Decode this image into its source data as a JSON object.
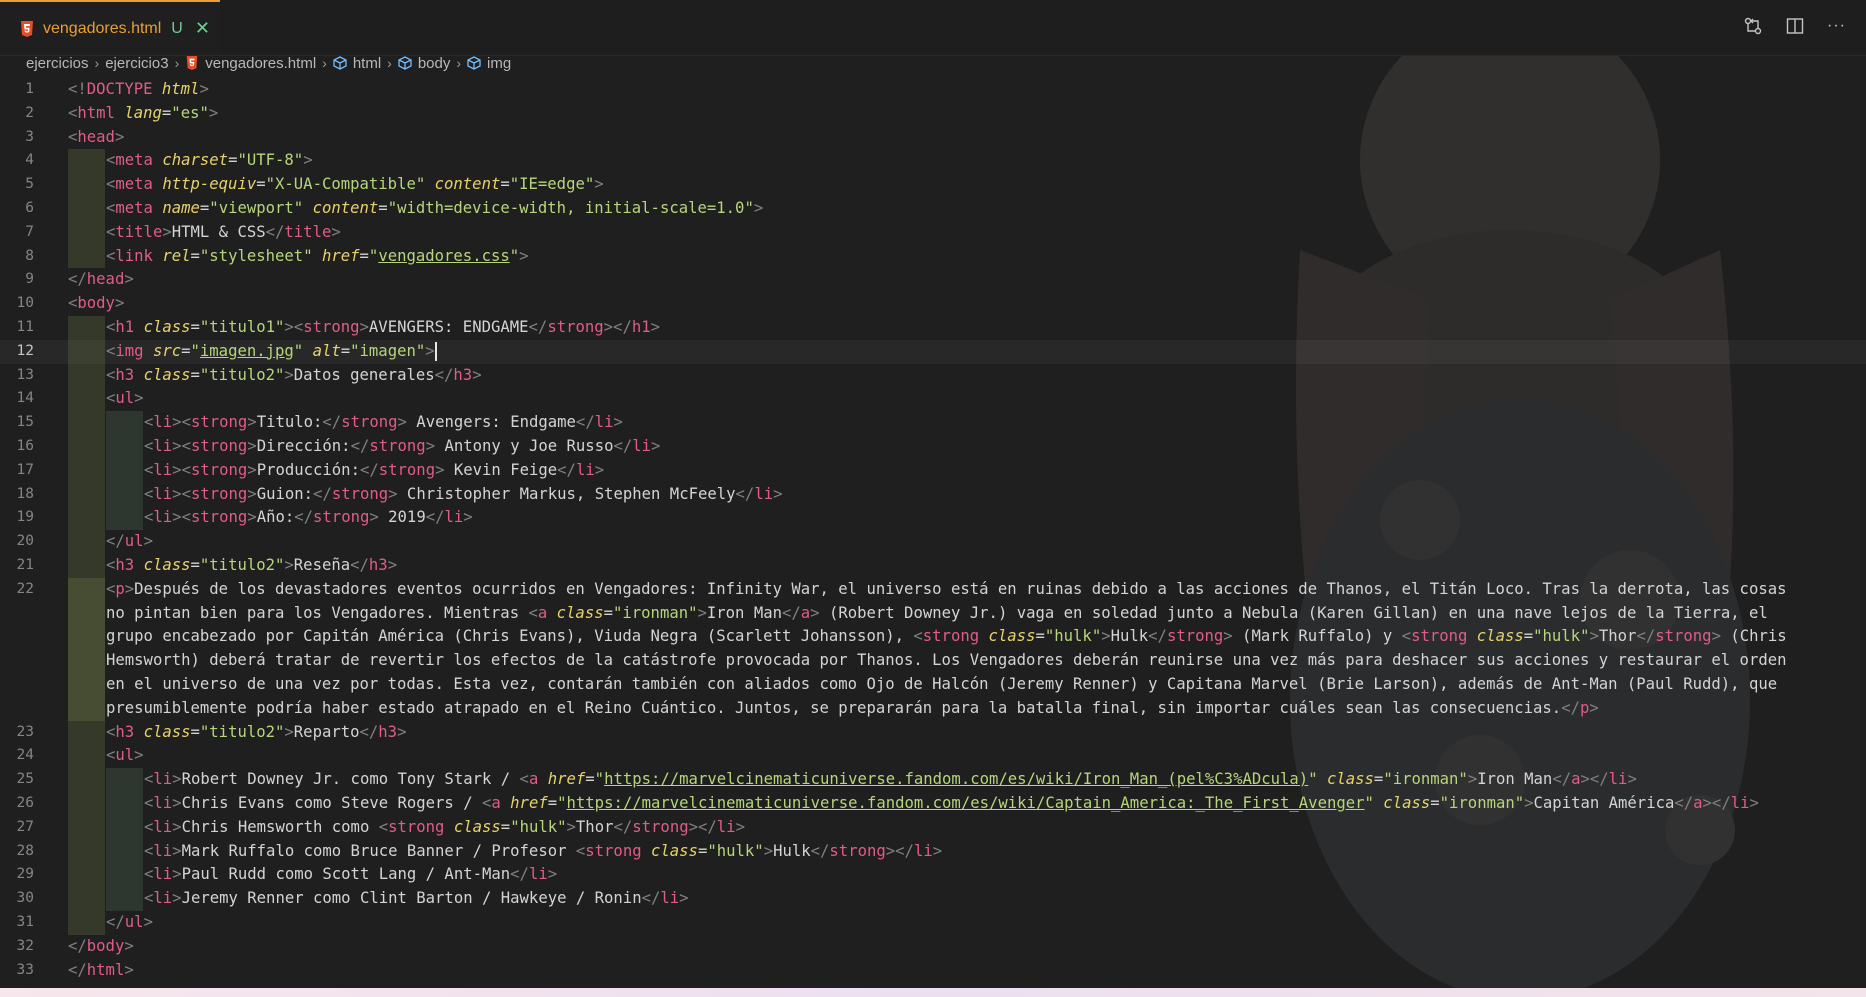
{
  "tab": {
    "filename": "vengadores.html",
    "status": "U",
    "close": "✕"
  },
  "toolbar": {
    "icons": [
      "source-control-compare-icon",
      "split-editor-icon",
      "more-actions-icon"
    ],
    "more_label": "···"
  },
  "breadcrumb": {
    "items": [
      "ejercicios",
      "ejercicio3",
      "vengadores.html",
      "html",
      "body",
      "img"
    ]
  },
  "editor": {
    "active_line": 12,
    "lines": [
      "<!DOCTYPE html>",
      "<html lang=\"es\">",
      "<head>",
      "<meta charset=\"UTF-8\">",
      "<meta http-equiv=\"X-UA-Compatible\" content=\"IE=edge\">",
      "<meta name=\"viewport\" content=\"width=device-width, initial-scale=1.0\">",
      "<title>HTML & CSS</title>",
      "<link rel=\"stylesheet\" href=\"vengadores.css\">",
      "</head>",
      "<body>",
      "<h1 class=\"titulo1\"><strong>AVENGERS: ENDGAME</strong></h1>",
      "<img src=\"imagen.jpg\" alt=\"imagen\">",
      "<h3 class=\"titulo2\">Datos generales</h3>",
      "<ul>",
      "<li><strong>Titulo:</strong> Avengers: Endgame</li>",
      "<li><strong>Dirección:</strong> Antony y Joe Russo</li>",
      "<li><strong>Producción:</strong> Kevin Feige</li>",
      "<li><strong>Guion:</strong> Christopher Markus, Stephen McFeely</li>",
      "<li><strong>Año:</strong> 2019</li>",
      "</ul>",
      "<h3 class=\"titulo2\">Reseña</h3>",
      "<p>Después de los devastadores eventos ocurridos en Vengadores: Infinity War, el universo está en ruinas debido a las acciones de Thanos, el Titán Loco. Tras la derrota, las cosas no pintan bien para los Vengadores. Mientras <a class=\"ironman\">Iron Man</a> (Robert Downey Jr.) vaga en soledad junto a Nebula (Karen Gillan) en una nave lejos de la Tierra, el grupo encabezado por Capitán América (Chris Evans), Viuda Negra (Scarlett Johansson), <strong class=\"hulk\">Hulk</strong> (Mark Ruffalo) y <strong class=\"hulk\">Thor</strong> (Chris Hemsworth) deberá tratar de revertir los efectos de la catástrofe provocada por Thanos. Los Vengadores deberán reunirse una vez más para deshacer sus acciones y restaurar el orden en el universo de una vez por todas. Esta vez, contarán también con aliados como Ojo de Halcón (Jeremy Renner) y Capitana Marvel (Brie Larson), además de Ant-Man (Paul Rudd), que presumiblemente podría haber estado atrapado en el Reino Cuántico. Juntos, se prepararán para la batalla final, sin importar cuáles sean las consecuencias.</p>",
      "<h3 class=\"titulo2\">Reparto</h3>",
      "<ul>",
      "<li>Robert Downey Jr. como Tony Stark / <a href=\"https://marvelcinematicuniverse.fandom.com/es/wiki/Iron_Man_(pel%C3%ADcula)\" class=\"ironman\">Iron Man</a></li>",
      "<li>Chris Evans como Steve Rogers / <a href=\"https://marvelcinematicuniverse.fandom.com/es/wiki/Captain_America:_The_First_Avenger\" class=\"ironman\">Capitan América</a></li>",
      "<li>Chris Hemsworth como <strong class=\"hulk\">Thor</strong></li>",
      "<li>Mark Ruffalo como Bruce Banner / Profesor <strong class=\"hulk\">Hulk</strong></li>",
      "<li>Paul Rudd como Scott Lang / Ant-Man</li>",
      "<li>Jeremy Renner como Clint Barton / Hawkeye / Ronin</li>",
      "</ul>",
      "</body>",
      "</html>"
    ],
    "indents": [
      0,
      0,
      0,
      1,
      1,
      1,
      1,
      1,
      0,
      0,
      1,
      1,
      1,
      1,
      2,
      2,
      2,
      2,
      2,
      1,
      1,
      1,
      1,
      1,
      2,
      2,
      2,
      2,
      2,
      2,
      1,
      0,
      0
    ],
    "wrap_22": [
      "<p>Después de los devastadores eventos ocurridos en Vengadores: Infinity War, el universo está en ruinas debido a las acciones de Thanos, el Titán Loco. Tras la derrota, las cosas",
      "no pintan bien para los Vengadores. Mientras <a class=\"ironman\">Iron Man</a> (Robert Downey Jr.) vaga en soledad junto a Nebula (Karen Gillan) en una nave lejos de la Tierra, el",
      "grupo encabezado por Capitán América (Chris Evans), Viuda Negra (Scarlett Johansson), <strong class=\"hulk\">Hulk</strong> (Mark Ruffalo) y <strong class=\"hulk\">Thor</strong> (Chris",
      "Hemsworth) deberá tratar de revertir los efectos de la catástrofe provocada por Thanos. Los Vengadores deberán reunirse una vez más para deshacer sus acciones y restaurar el orden",
      "en el universo de una vez por todas. Esta vez, contarán también con aliados como Ojo de Halcón (Jeremy Renner) y Capitana Marvel (Brie Larson), además de Ant-Man (Paul Rudd), que",
      "presumiblemente podría haber estado atrapado en el Reino Cuántico. Juntos, se prepararán para la batalla final, sin importar cuáles sean las consecuencias.</p>"
    ]
  },
  "colors": {
    "tab_accent": "#e8a034",
    "untracked": "#73c991",
    "tag": "#e05c8a",
    "attr": "#e6d36b",
    "string": "#b5d67b",
    "background": "#1f1f1f"
  }
}
